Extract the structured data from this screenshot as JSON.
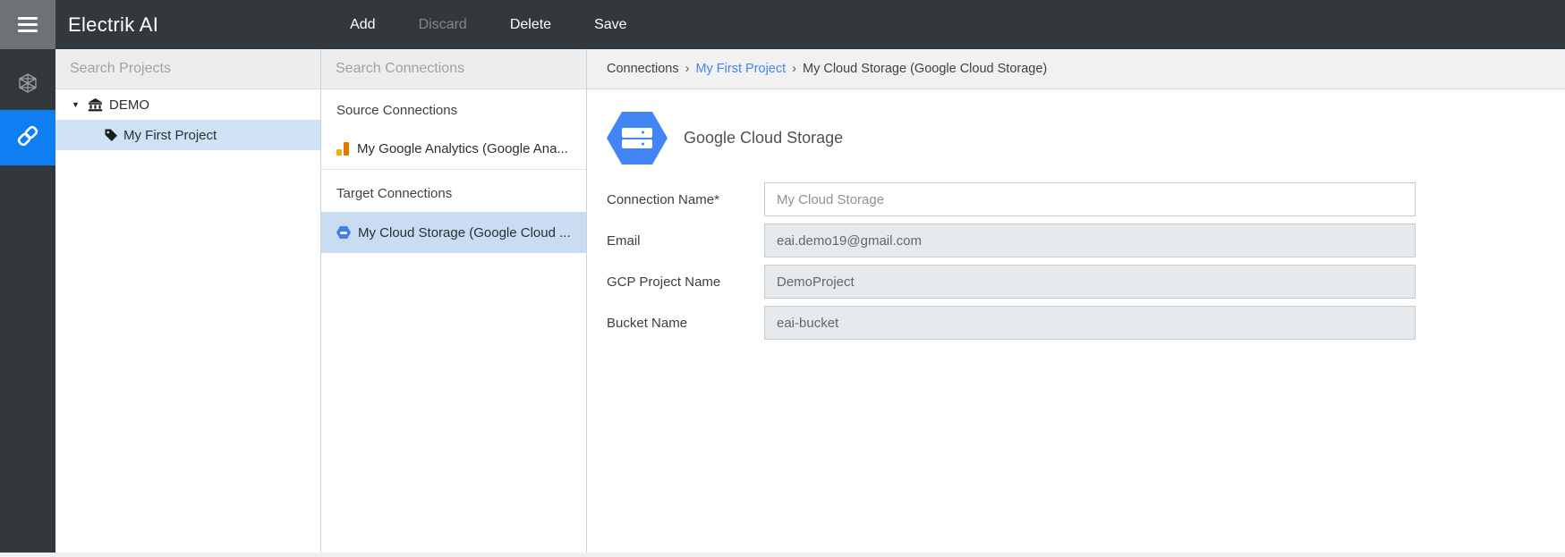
{
  "colors": {
    "topbar_bg": "#33383d",
    "accent_blue": "#0d7ff2",
    "link_blue": "#4286f5",
    "gcs_blue": "#4285f4",
    "ga_orange_light": "#f9ab00",
    "ga_orange_dark": "#e37400",
    "selection_blue": "#cfe2f5",
    "disabled_input_bg": "#e7eaec"
  },
  "topbar": {
    "title": "Electrik AI",
    "buttons": {
      "add": "Add",
      "discard": "Discard",
      "delete": "Delete",
      "save": "Save"
    }
  },
  "rail": {
    "items": [
      {
        "name": "projects",
        "icon": "hexagon-wireframe-icon",
        "active": false
      },
      {
        "name": "connections",
        "icon": "link-icon",
        "active": true
      }
    ]
  },
  "projects": {
    "search_placeholder": "Search Projects",
    "org": {
      "label": "DEMO",
      "expanded": true
    },
    "items": [
      {
        "label": "My First Project",
        "selected": true
      }
    ]
  },
  "connections": {
    "search_placeholder": "Search Connections",
    "source_header": "Source Connections",
    "source_items": [
      {
        "label": "My Google Analytics (Google Ana...",
        "icon": "google-analytics-icon",
        "selected": false
      }
    ],
    "target_header": "Target Connections",
    "target_items": [
      {
        "label": "My Cloud Storage (Google Cloud ...",
        "icon": "google-cloud-storage-icon",
        "selected": true
      }
    ]
  },
  "breadcrumb": {
    "root": "Connections",
    "sep": "›",
    "project": "My First Project",
    "current": "My Cloud Storage (Google Cloud Storage)"
  },
  "detail": {
    "title": "Google Cloud Storage",
    "fields": [
      {
        "label": "Connection Name*",
        "value": "My Cloud Storage",
        "disabled": false
      },
      {
        "label": "Email",
        "value": "eai.demo19@gmail.com",
        "disabled": true
      },
      {
        "label": "GCP Project Name",
        "value": "DemoProject",
        "disabled": true
      },
      {
        "label": "Bucket Name",
        "value": "eai-bucket",
        "disabled": true
      }
    ]
  }
}
